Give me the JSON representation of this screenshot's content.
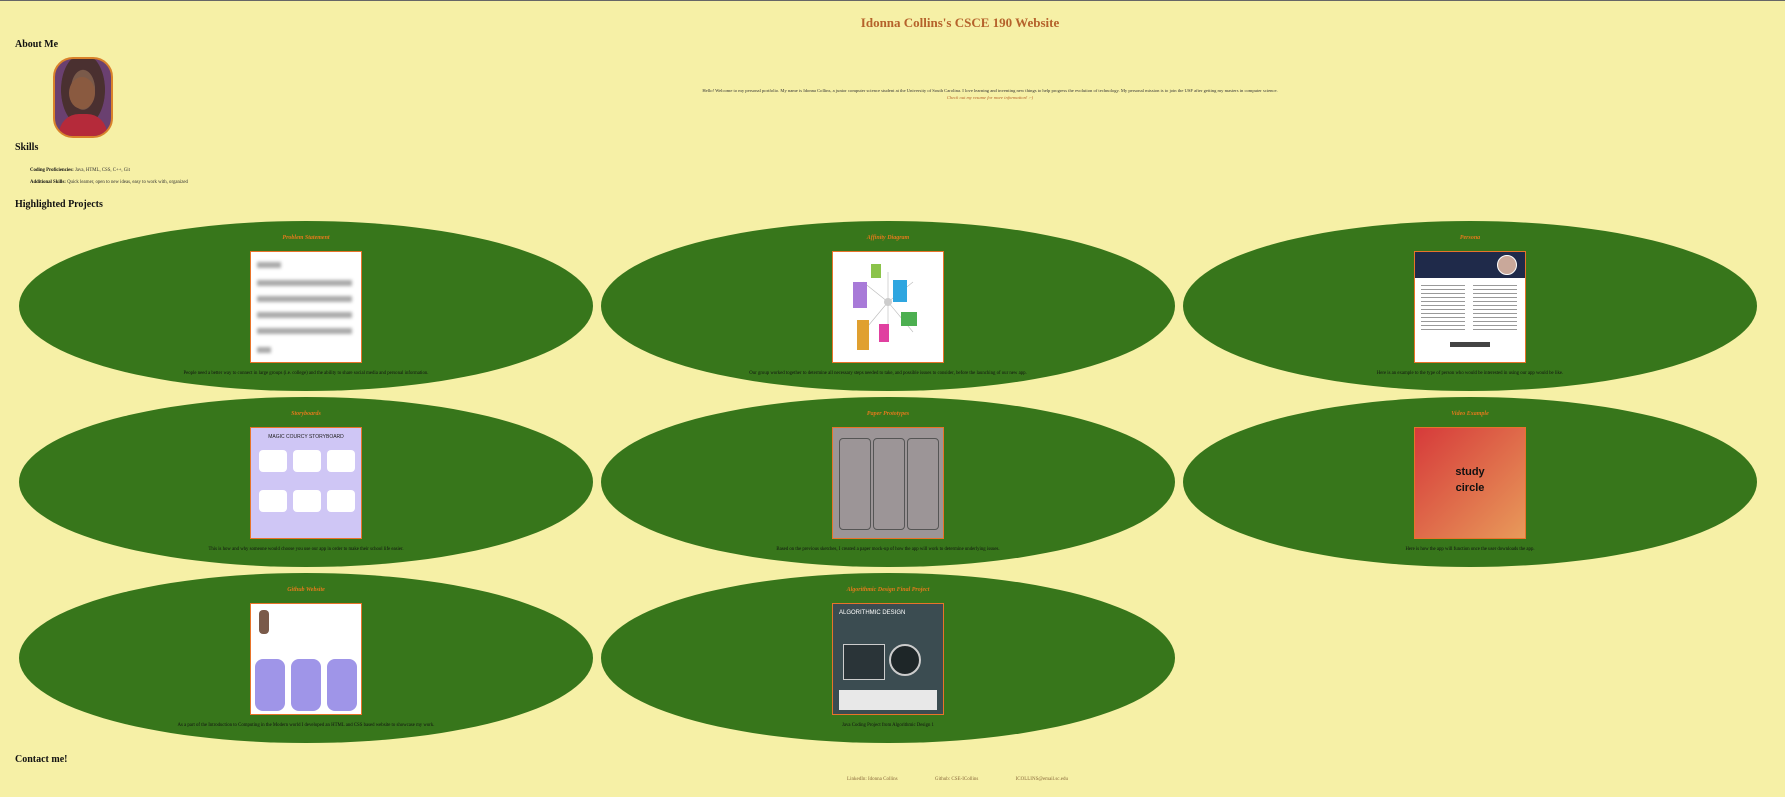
{
  "site_title": "Idonna Collins's CSCE 190 Website",
  "about": {
    "heading": "About Me",
    "bio": "Hello! Welcome to my personal portfolio. My name is Idonna Collins, a junior computer science student at the University of South Carolina. I love learning and inventing new things to help progress the evolution of technology. My personal mission is to join the USF after getting my masters in computer science.",
    "resume_link": "Check out my resume for more information! :-)"
  },
  "skills": {
    "heading": "Skills",
    "coding_label": "Coding Proficiencies:",
    "coding_value": "Java, HTML, CSS, C++, Git",
    "additional_label": "Additional Skills:",
    "additional_value": "Quick learner, open to new ideas, easy to work with, organized"
  },
  "projects": {
    "heading": "Highlighted Projects",
    "items": [
      {
        "title": "Problem Statement",
        "desc": "People need a better way to connect in large groups (i.e. college) and the ability to share social media and personal information."
      },
      {
        "title": "Affinity Diagram",
        "desc": "Our group worked together to determine all necessary steps needed to take, and possible issues to consider, before the launching of our new app."
      },
      {
        "title": "Persona",
        "desc": "Here is an example to the type of person who would be interested in using our app would be like."
      },
      {
        "title": "Storyboards",
        "desc": "This is how and why someone would choose you use our app in order to make their school life easier."
      },
      {
        "title": "Paper Prototypes",
        "desc": "Based on the previous sketches, I created a paper mock-up of how the app will work to determine underlying issues."
      },
      {
        "title": "Video Example",
        "desc": "Here is how the app will function once the user downloads the app."
      },
      {
        "title": "Github Website",
        "desc": "As a part of the Introduction to Computing in the Modern world I developed an HTML and CSS based website to showcase my work."
      },
      {
        "title": "Algorithmic Design Final Project",
        "desc": "Java Coding Project from Algorithmic Design 1"
      }
    ]
  },
  "contact": {
    "heading": "Contact me!",
    "linkedin": "LinkedIn: Idonna Collins",
    "github": "Github: CSE-ICollins",
    "email": "ICOLLINS@email.sc.edu"
  },
  "thumb_text": {
    "story_title": "MAGIC COURCY STORYBOARD",
    "algo_title": "ALGORITHMIC DESIGN",
    "video_word1": "study",
    "video_word2": "circle"
  }
}
